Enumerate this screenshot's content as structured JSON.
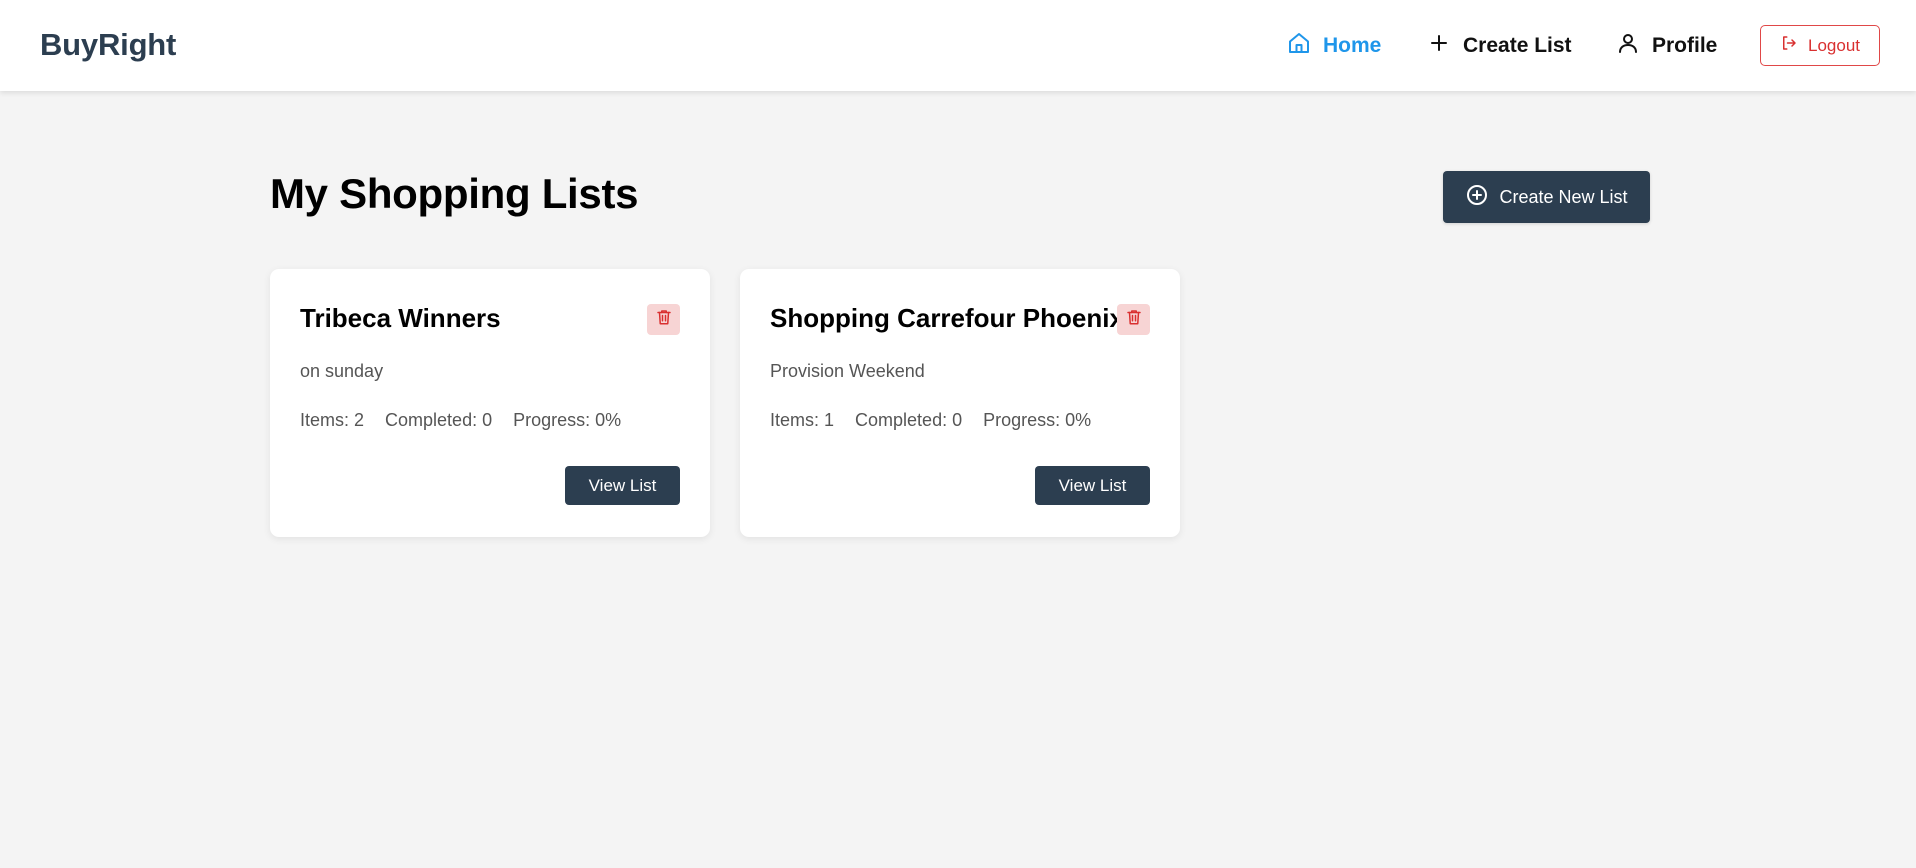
{
  "header": {
    "brand": "BuyRight",
    "nav": {
      "home": "Home",
      "create_list": "Create List",
      "profile": "Profile"
    },
    "logout": "Logout",
    "accent_color": "#1f96ea",
    "logout_color": "#d93030"
  },
  "main": {
    "title": "My Shopping Lists",
    "create_button": "Create New List",
    "lists": [
      {
        "title": "Tribeca Winners",
        "description": "on sunday",
        "items": "Items: 2",
        "completed": "Completed: 0",
        "progress": "Progress: 0%",
        "view_button": "View List"
      },
      {
        "title": "Shopping Carrefour Phoenix",
        "description": "Provision Weekend",
        "items": "Items: 1",
        "completed": "Completed: 0",
        "progress": "Progress: 0%",
        "view_button": "View List"
      }
    ]
  },
  "icons": {
    "home": "home-icon",
    "create": "plus-icon",
    "profile": "user-icon",
    "logout": "logout-icon",
    "create_new": "plus-circle-icon",
    "delete": "trash-icon"
  },
  "colors": {
    "primary_dark": "#2c3e50",
    "background": "#f4f4f4",
    "delete_bg": "#f7d4d4",
    "delete_icon": "#d93030"
  }
}
